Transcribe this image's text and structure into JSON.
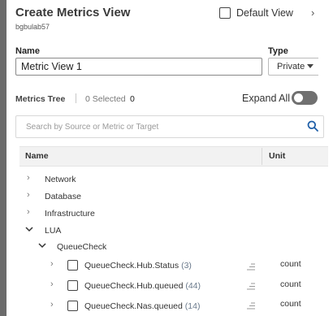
{
  "header": {
    "title": "Create Metrics View",
    "subtitle": "bgbulab57",
    "default_view_label": "Default View"
  },
  "form": {
    "name_label": "Name",
    "name_value": "Metric View 1",
    "type_label": "Type",
    "type_value": "Private"
  },
  "metrics_tree": {
    "label": "Metrics Tree",
    "selected_label": "0 Selected",
    "selected_count": "0",
    "expand_all_label": "Expand All",
    "expand_all_on": false,
    "search_placeholder": "Search by Source or Metric or Target"
  },
  "table": {
    "col_name": "Name",
    "col_unit": "Unit"
  },
  "tree": {
    "groups": [
      "Network",
      "Database",
      "Infrastructure",
      "LUA"
    ],
    "subgroup": "QueueCheck",
    "metrics": [
      {
        "name": "QueueCheck.Hub.Status",
        "count": "(3)",
        "unit": "count"
      },
      {
        "name": "QueueCheck.Hub.queued",
        "count": "(44)",
        "unit": "count"
      },
      {
        "name": "QueueCheck.Nas.queued",
        "count": "(14)",
        "unit": "count"
      }
    ]
  },
  "icons": {
    "search": "search-icon",
    "expand": "chevron-right-icon",
    "collapse": "chevron-down-icon",
    "sort": "sort-lines-icon"
  },
  "colors": {
    "accent": "#1f5fa8",
    "toggle_off": "#707070",
    "count_text": "#6a7a8c"
  }
}
